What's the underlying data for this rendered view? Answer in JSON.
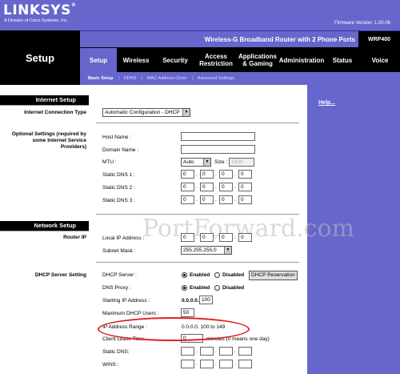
{
  "brand": {
    "logo": "LINKSYS",
    "reg": "®",
    "subtitle": "A Division of Cisco Systems, Inc."
  },
  "firmware": "Firmware Version: 1.00.06",
  "page_title": "Setup",
  "product": {
    "name": "Wireless-G Broadband Router with 2 Phone Ports",
    "model": "WRP400"
  },
  "tabs": [
    {
      "label": "Setup",
      "active": true
    },
    {
      "label": "Wireless",
      "active": false
    },
    {
      "label": "Security",
      "active": false
    },
    {
      "label": "Access Restriction",
      "active": false
    },
    {
      "label": "Applications & Gaming",
      "active": false
    },
    {
      "label": "Administration",
      "active": false
    },
    {
      "label": "Status",
      "active": false
    },
    {
      "label": "Voice",
      "active": false
    }
  ],
  "subtabs": [
    "Basic Setup",
    "DDNS",
    "MAC Address Clone",
    "Advanced Settings"
  ],
  "subtab_separator": "|",
  "sections": {
    "internet_setup": "Internet Setup",
    "network_setup": "Network Setup"
  },
  "left_labels": {
    "internet_connection_type": "Internet Connection Type",
    "optional_settings": "Optional Settings (required by some Internet Service Providers)",
    "router_ip": "Router IP",
    "dhcp_server_setting": "DHCP Server Setting"
  },
  "help_link": "Help...",
  "connection_type": {
    "value": "Automatic Configuration - DHCP"
  },
  "optional": {
    "host_name_label": "Host Name :",
    "host_name_value": "",
    "domain_name_label": "Domain Name :",
    "domain_name_value": "",
    "mtu_label": "MTU :",
    "mtu_value": "Auto",
    "size_label": "Size :",
    "size_value": "1500",
    "dns1_label": "Static DNS 1 :",
    "dns2_label": "Static DNS 2 :",
    "dns3_label": "Static DNS 3 :",
    "dns_octets": [
      "0",
      "0",
      "0",
      "0"
    ]
  },
  "router_ip": {
    "local_ip_label": "Local IP Address :",
    "local_ip_octets": [
      "0",
      "0",
      "0",
      "0"
    ],
    "subnet_label": "Subnet Mask :",
    "subnet_value": "255.255.255.0"
  },
  "dhcp": {
    "server_label": "DHCP Server :",
    "enabled_label": "Enabled",
    "disabled_label": "Disabled",
    "reservation_button": "DHCP Reservation",
    "dns_proxy_label": "DNS Proxy :",
    "starting_ip_label": "Starting IP Address :",
    "starting_ip_prefix": "0.0.0.0.",
    "starting_ip_value": "100",
    "max_users_label": "Maximum DHCP Users :",
    "max_users_value": "50",
    "ip_range_label": "IP Address Range :",
    "ip_range_value": "0.0.0.0. 100 to 149",
    "lease_label": "Client Lease Time :",
    "lease_value": "0",
    "lease_suffix": "minutes (0 means one day)",
    "static_dns_label": "Static DNS:",
    "wins_label": "WINS :"
  },
  "watermark": "PortForward.com",
  "colors": {
    "brand_purple": "#6666cc",
    "highlight": "#dd2222"
  }
}
